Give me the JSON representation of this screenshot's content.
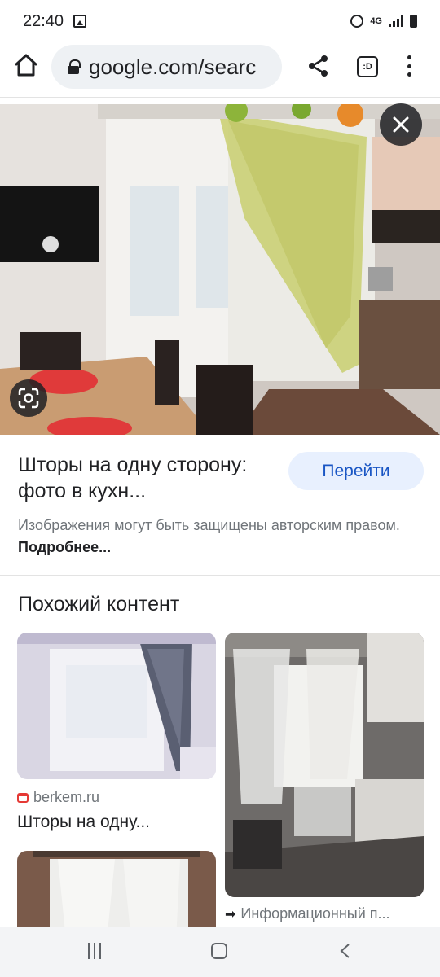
{
  "status_bar": {
    "time": "22:40",
    "network": "4G"
  },
  "browser": {
    "url": "google.com/searc",
    "tabs_label": ":D"
  },
  "result": {
    "title": "Шторы на одну сторону: фото в кухн...",
    "visit_button": "Перейти",
    "copyright_text": "Изображения могут быть защищены авторским правом.",
    "copyright_link": "Подробнее..."
  },
  "related": {
    "heading": "Похожий контент",
    "items": [
      {
        "source": "berkem.ru",
        "title": "Шторы на одну..."
      },
      {
        "source": "Информационный п..."
      }
    ]
  },
  "icons": {
    "home": "home-icon",
    "lock": "lock-icon",
    "share": "share-icon",
    "tabs": "tab-switcher-icon",
    "menu": "more-vert-icon",
    "close": "close-icon",
    "lens": "google-lens-icon",
    "back": "back-icon"
  },
  "colors": {
    "accent": "#1a56c4",
    "button_bg": "#e8f0fe",
    "secondary_text": "#70757a"
  }
}
